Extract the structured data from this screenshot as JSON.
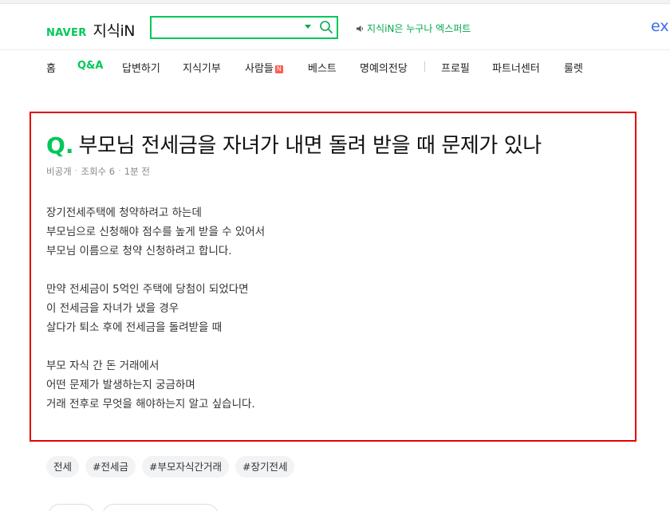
{
  "header": {
    "logo_naver": "NAVER",
    "logo_kin": "지식iN",
    "search": {
      "value": "",
      "placeholder": ""
    },
    "promo_text": "지식iN은 누구나 엑스퍼트",
    "ex_logo": "ex"
  },
  "nav": {
    "items": [
      {
        "label": "홈"
      },
      {
        "label": "Q&A"
      },
      {
        "label": "답변하기"
      },
      {
        "label": "지식기부"
      },
      {
        "label": "사람들",
        "badge": "N"
      },
      {
        "label": "베스트"
      },
      {
        "label": "명예의전당"
      },
      {
        "label": "프로필"
      },
      {
        "label": "파트너센터"
      },
      {
        "label": "룰렛"
      }
    ],
    "active": "Q&A"
  },
  "question": {
    "q_mark": "Q",
    "title": "부모님 전세금을 자녀가 내면 돌려 받을 때 문제가 있나",
    "meta": {
      "author": "비공개",
      "views": "조회수 6",
      "time": "1분 전"
    },
    "paragraphs": [
      [
        "장기전세주택에 청약하려고 하는데",
        "부모님으로 신청해야 점수를 높게 받을 수 있어서",
        "부모님 이름으로 청약 신청하려고 합니다."
      ],
      [
        "만약 전세금이 5억인 주택에 당첨이 되었다면",
        "이 전세금을 자녀가 냈을 경우",
        "살다가 퇴소 후에 전세금을 돌려받을 때"
      ],
      [
        "부모 자식 간 돈 거래에서",
        "어떤 문제가 발생하는지 궁금하며",
        "거래 전후로 무엇을 해야하는지 알고 싶습니다."
      ]
    ]
  },
  "tags": [
    "전세",
    "#전세금",
    "#부모자식간거래",
    "#장기전세"
  ],
  "colors": {
    "brand_green": "#03c75a",
    "highlight_red": "#e50000",
    "ex_blue": "#3b6cf0",
    "badge_red": "#ff5a4e"
  }
}
